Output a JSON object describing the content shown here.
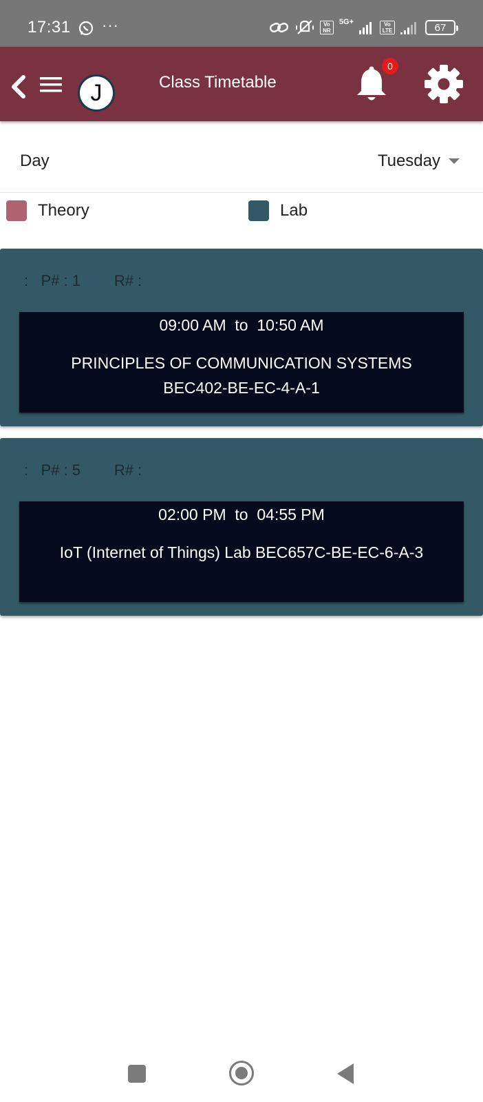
{
  "status_bar": {
    "time": "17:31",
    "dots": "···",
    "vo_nr": "Vo NR",
    "network_label": "5G+",
    "vo_lte": "Vo LTE",
    "battery": "67"
  },
  "app_bar": {
    "logo_letter": "J",
    "title": "Class Timetable",
    "notification_count": "0",
    "colors": {
      "background": "#7a3140",
      "badge": "#e21b1b"
    }
  },
  "day_selector": {
    "label": "Day",
    "selected": "Tuesday"
  },
  "legend": {
    "items": [
      {
        "label": "Theory",
        "color": "#b06270"
      },
      {
        "label": "Lab",
        "color": "#335966"
      }
    ]
  },
  "classes": [
    {
      "meta": ":   P# : 1        R# :",
      "time": "09:00 AM  to  10:50 AM",
      "subject": "PRINCIPLES OF COMMUNICATION SYSTEMS BEC402-BE-EC-4-A-1"
    },
    {
      "meta": ":   P# : 5        R# :",
      "time": "02:00 PM  to  04:55 PM",
      "subject": "IoT (Internet of Things) Lab BEC657C-BE-EC-6-A-3"
    }
  ],
  "icons": {
    "back": "chevron-left-icon",
    "menu": "hamburger-menu-icon",
    "notifications": "bell-icon",
    "settings": "gear-icon"
  }
}
